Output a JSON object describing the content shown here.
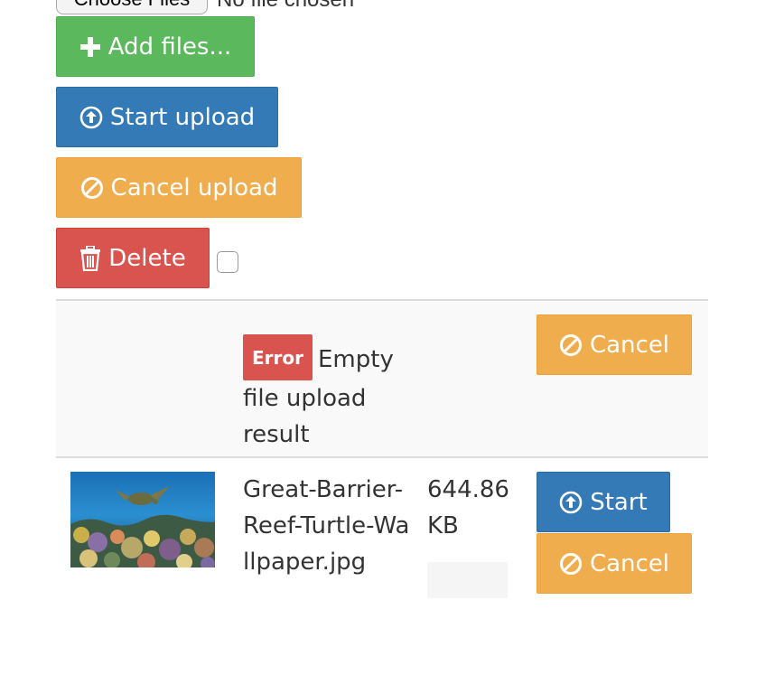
{
  "file_input": {
    "button_label": "Choose Files",
    "status_text": "No file chosen"
  },
  "toolbar": {
    "add_files_label": "Add files...",
    "start_upload_label": "Start upload",
    "cancel_upload_label": "Cancel upload",
    "delete_label": "Delete",
    "select_all_checked": false
  },
  "files": [
    {
      "error_badge": "Error",
      "error_message": "Empty file upload result",
      "cancel_label": "Cancel"
    },
    {
      "name": "Great-Barrier-Reef-Turtle-Wallpaper.jpg",
      "size": "644.86 KB",
      "progress": 0,
      "start_label": "Start",
      "cancel_label": "Cancel"
    }
  ],
  "colors": {
    "success": "#5cb85c",
    "primary": "#337ab7",
    "warning": "#f0ad4e",
    "danger": "#d9534f",
    "row_stripe": "#f9f9f9",
    "row_border": "#dddddd"
  },
  "icons": {
    "add": "plus-icon",
    "start": "circle-arrow-up-icon",
    "cancel": "ban-circle-icon",
    "delete": "trash-icon"
  }
}
